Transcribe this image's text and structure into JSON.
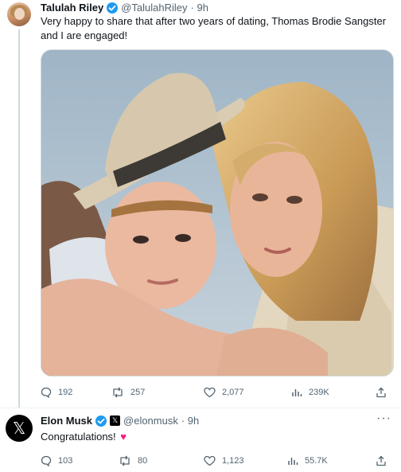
{
  "tweets": [
    {
      "author_name": "Talulah Riley",
      "handle": "@TalulahRiley",
      "time": "· 9h",
      "text_line1": "Very happy to share that after two years of dating, Thomas Brodie Sangster",
      "text_line2": "and I are engaged!",
      "more_label": "···",
      "stats": {
        "replies": "192",
        "reposts": "257",
        "likes": "2,077",
        "views": "239K"
      },
      "badge_color": "#1d9bf0"
    },
    {
      "author_name": "Elon Musk",
      "handle": "@elonmusk",
      "time": "· 9h",
      "text": "Congratulations!",
      "heart": "♥",
      "more_label": "···",
      "avatar_glyph": "𝕏",
      "affiliation_glyph": "𝕏",
      "stats": {
        "replies": "103",
        "reposts": "80",
        "likes": "1,123",
        "views": "55.7K"
      },
      "badge_color": "#1d9bf0"
    }
  ],
  "icons": [
    "reply-icon",
    "repost-icon",
    "like-icon",
    "views-icon",
    "share-icon",
    "verified-badge-icon",
    "more-icon"
  ]
}
